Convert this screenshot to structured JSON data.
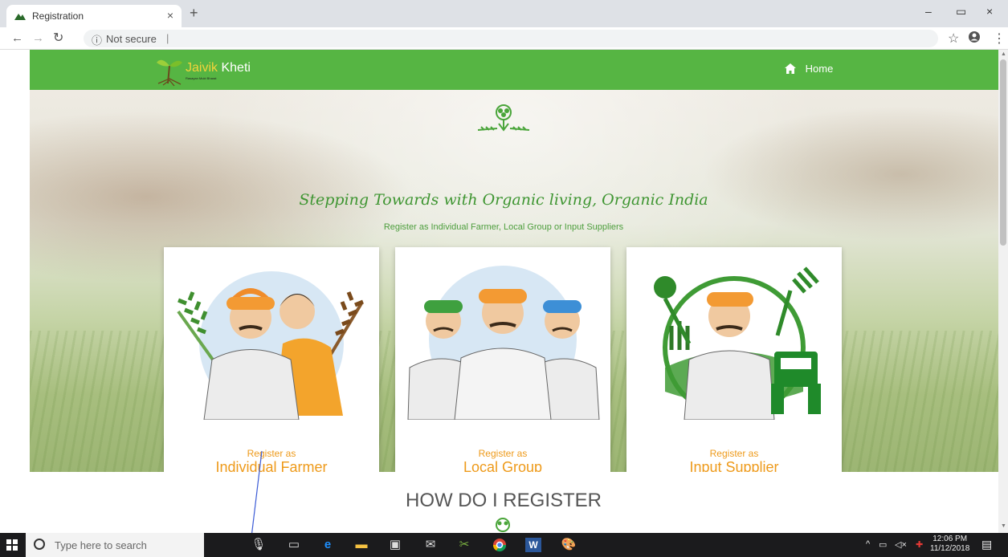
{
  "browser": {
    "tab_title": "Registration",
    "tab_close": "×",
    "new_tab": "+",
    "url_security": "Not secure",
    "url_text": "|",
    "window_controls": [
      "–",
      "▭",
      "×"
    ]
  },
  "nav": {
    "logo_word1": "Jaivik",
    "logo_word2": "Kheti",
    "logo_sub": "Rasayan Mukt Bharat",
    "home_label": "Home"
  },
  "hero": {
    "tagline": "Stepping Towards with Organic living, Organic India",
    "subline": "Register as Individual Farmer, Local Group or Input Suppliers"
  },
  "cards": [
    {
      "prefix": "Register as",
      "title": "Individual Farmer",
      "icon": "farmer-couple-illustration"
    },
    {
      "prefix": "Register as",
      "title": "Local Group",
      "icon": "farmer-group-illustration"
    },
    {
      "prefix": "Register as",
      "title": "Input Supplier",
      "icon": "supplier-tractor-illustration"
    }
  ],
  "section": {
    "heading": "HOW DO I REGISTER"
  },
  "taskbar": {
    "search_placeholder": "Type here to search",
    "time": "12:06 PM",
    "date": "11/12/2018"
  },
  "colors": {
    "nav_green": "#56b543",
    "accent_orange": "#ee9a1a",
    "tagline_green": "#3e9531"
  }
}
